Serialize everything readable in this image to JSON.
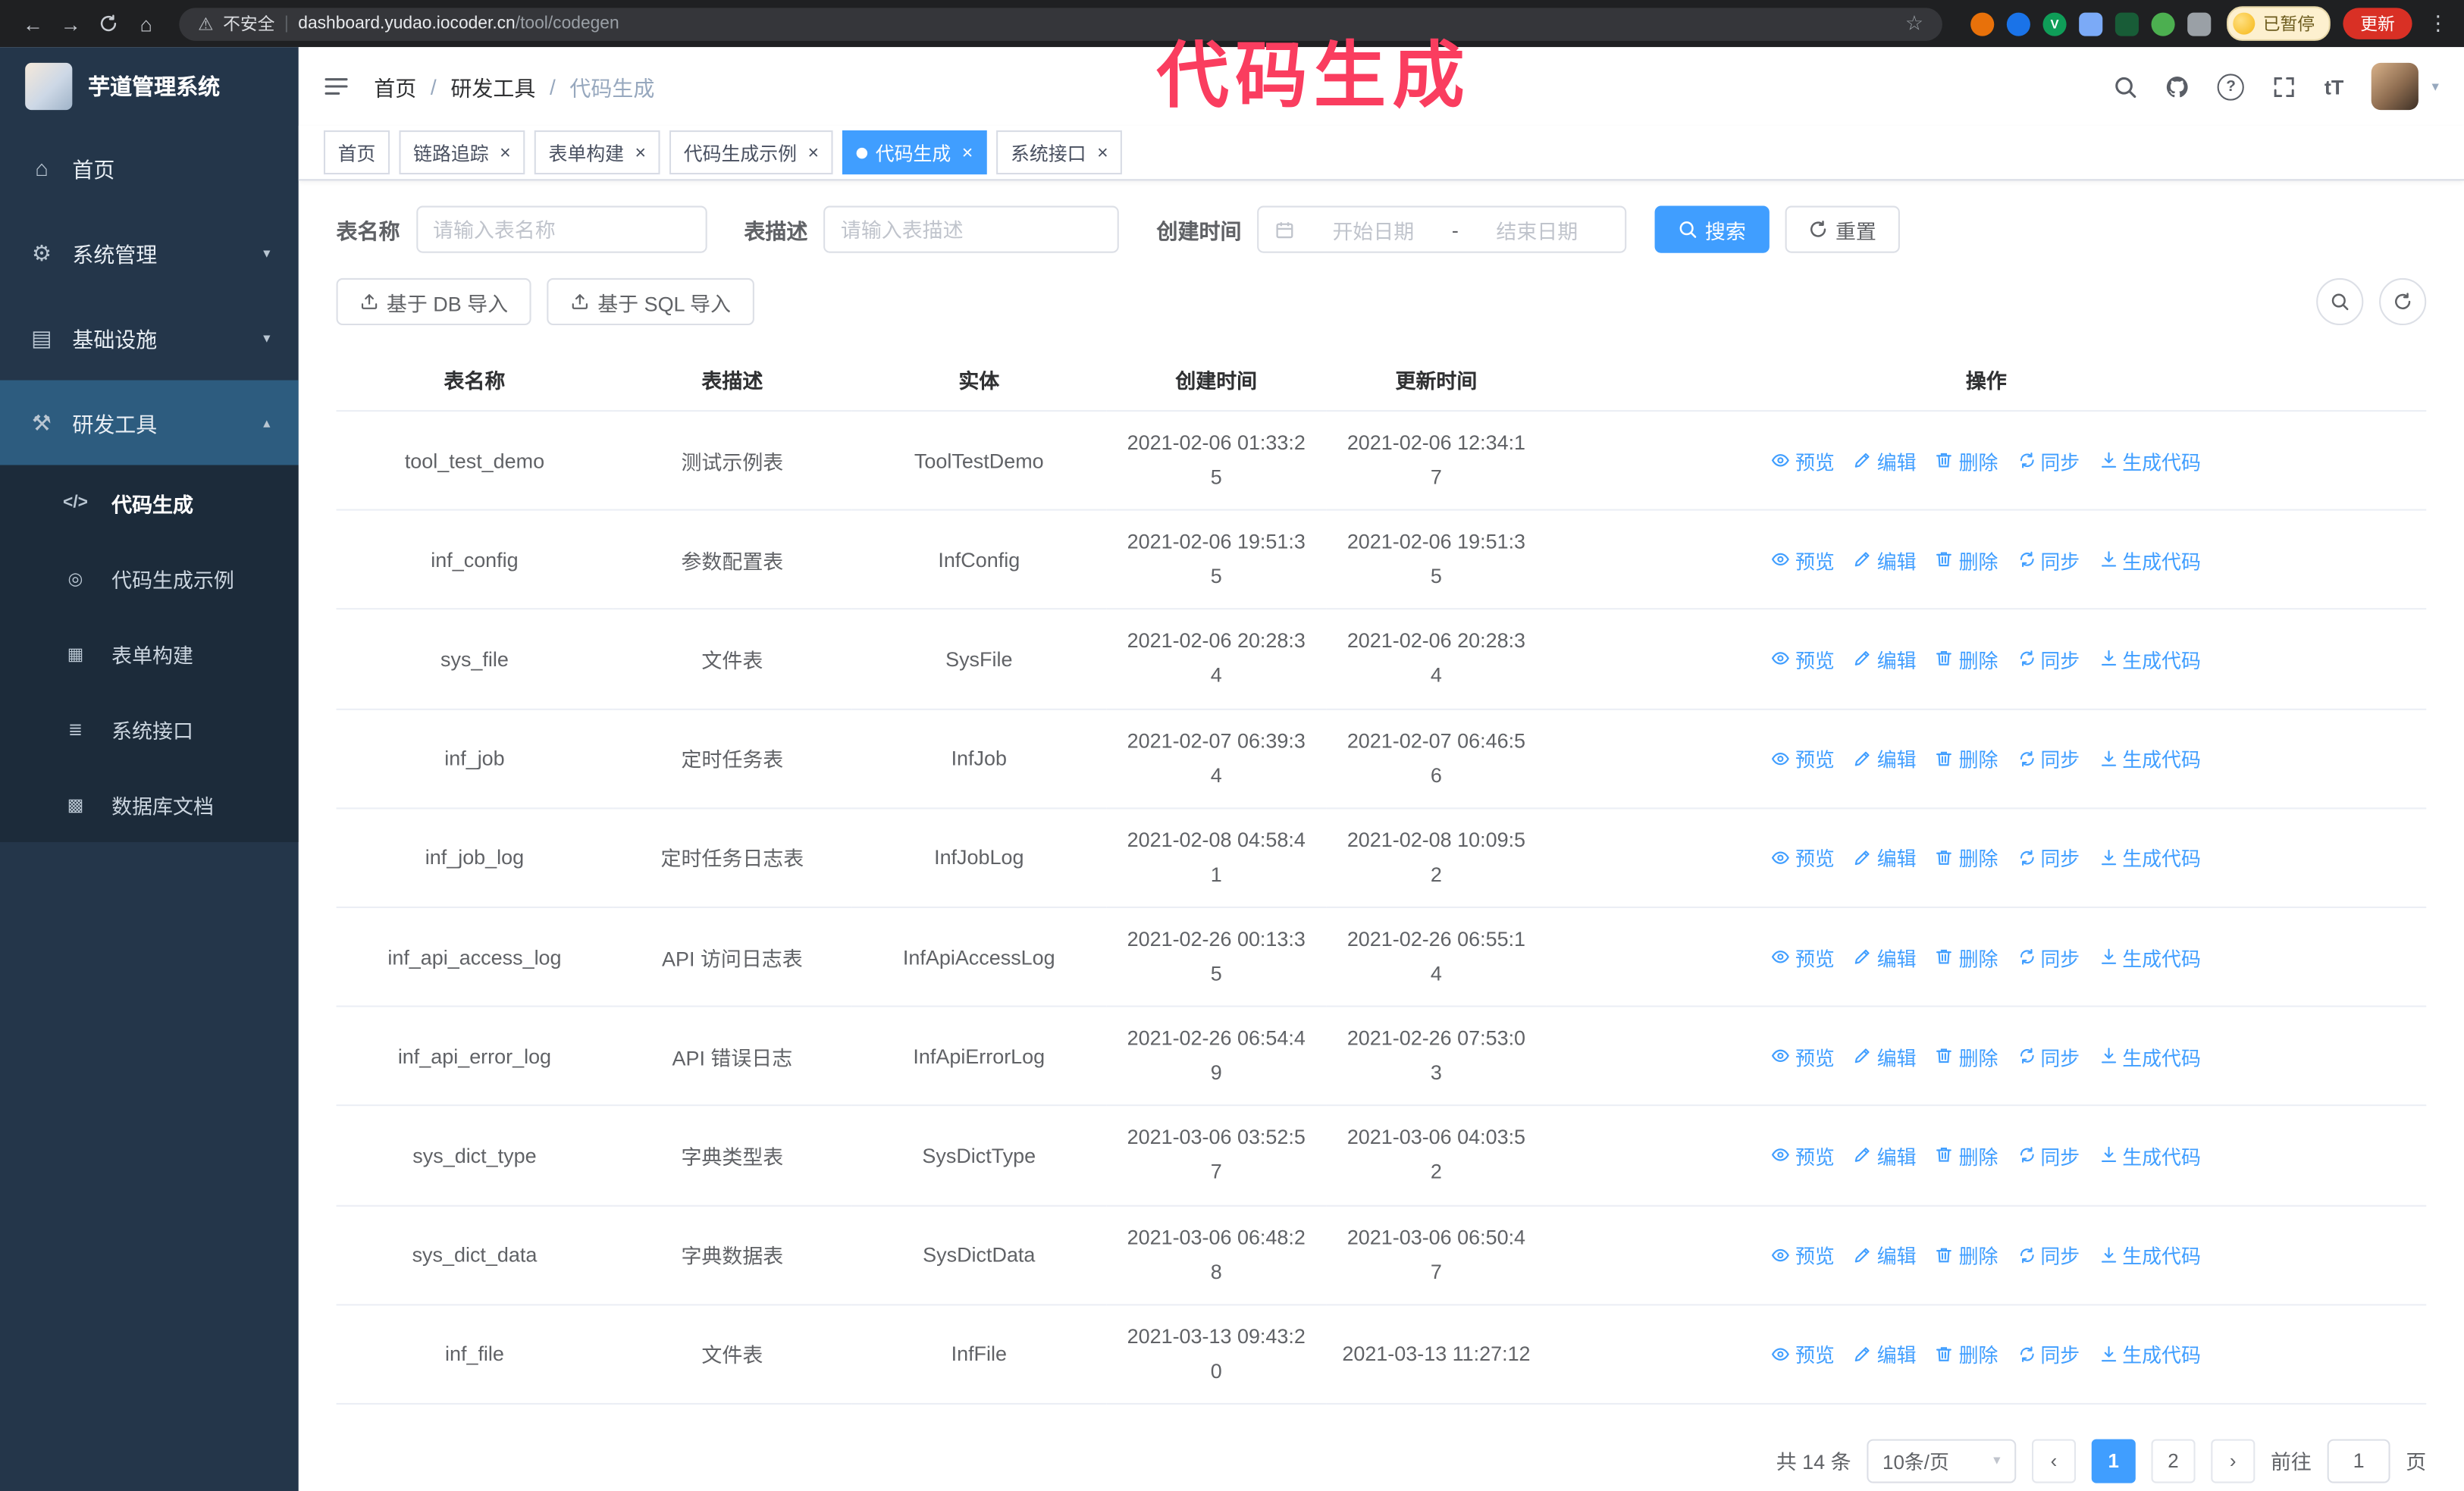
{
  "browser": {
    "security_warning": "不安全",
    "url_host": "dashboard.yudao.iocoder.cn",
    "url_path": "/tool/codegen",
    "paused_badge": "已暂停",
    "update_button": "更新"
  },
  "annotation": {
    "text": "代码生成",
    "color": "#fa3d5f"
  },
  "colors": {
    "accent": "#409eff"
  },
  "sidebar": {
    "logo_title": "芋道管理系统",
    "items": [
      {
        "label": "首页",
        "icon": "home-icon"
      },
      {
        "label": "系统管理",
        "icon": "gear-icon",
        "expandable": true
      },
      {
        "label": "基础设施",
        "icon": "infra-icon",
        "expandable": true
      },
      {
        "label": "研发工具",
        "icon": "tools-icon",
        "expandable": true,
        "expanded": true,
        "children": [
          {
            "label": "代码生成",
            "icon": "code-icon",
            "active": true
          },
          {
            "label": "代码生成示例",
            "icon": "example-icon"
          },
          {
            "label": "表单构建",
            "icon": "form-icon"
          },
          {
            "label": "系统接口",
            "icon": "api-icon"
          },
          {
            "label": "数据库文档",
            "icon": "dbdoc-icon"
          }
        ]
      }
    ]
  },
  "header": {
    "breadcrumb": [
      "首页",
      "研发工具",
      "代码生成"
    ]
  },
  "tabs": [
    {
      "label": "首页",
      "closable": false,
      "active": false
    },
    {
      "label": "链路追踪",
      "closable": true,
      "active": false
    },
    {
      "label": "表单构建",
      "closable": true,
      "active": false
    },
    {
      "label": "代码生成示例",
      "closable": true,
      "active": false
    },
    {
      "label": "代码生成",
      "closable": true,
      "active": true
    },
    {
      "label": "系统接口",
      "closable": true,
      "active": false
    }
  ],
  "filters": {
    "table_name_label": "表名称",
    "table_name_placeholder": "请输入表名称",
    "table_desc_label": "表描述",
    "table_desc_placeholder": "请输入表描述",
    "create_time_label": "创建时间",
    "date_start_placeholder": "开始日期",
    "date_separator": "-",
    "date_end_placeholder": "结束日期",
    "search_button": "搜索",
    "reset_button": "重置"
  },
  "toolbar": {
    "import_db": "基于 DB 导入",
    "import_sql": "基于 SQL 导入"
  },
  "table": {
    "columns": [
      "表名称",
      "表描述",
      "实体",
      "创建时间",
      "更新时间",
      "操作"
    ],
    "actions": [
      "预览",
      "编辑",
      "删除",
      "同步",
      "生成代码"
    ],
    "rows": [
      {
        "name": "tool_test_demo",
        "desc": "测试示例表",
        "entity": "ToolTestDemo",
        "created": "2021-02-06 01:33:25",
        "updated": "2021-02-06 12:34:17"
      },
      {
        "name": "inf_config",
        "desc": "参数配置表",
        "entity": "InfConfig",
        "created": "2021-02-06 19:51:35",
        "updated": "2021-02-06 19:51:35"
      },
      {
        "name": "sys_file",
        "desc": "文件表",
        "entity": "SysFile",
        "created": "2021-02-06 20:28:34",
        "updated": "2021-02-06 20:28:34"
      },
      {
        "name": "inf_job",
        "desc": "定时任务表",
        "entity": "InfJob",
        "created": "2021-02-07 06:39:34",
        "updated": "2021-02-07 06:46:56"
      },
      {
        "name": "inf_job_log",
        "desc": "定时任务日志表",
        "entity": "InfJobLog",
        "created": "2021-02-08 04:58:41",
        "updated": "2021-02-08 10:09:52"
      },
      {
        "name": "inf_api_access_log",
        "desc": "API 访问日志表",
        "entity": "InfApiAccessLog",
        "created": "2021-02-26 00:13:35",
        "updated": "2021-02-26 06:55:14"
      },
      {
        "name": "inf_api_error_log",
        "desc": "API 错误日志",
        "entity": "InfApiErrorLog",
        "created": "2021-02-26 06:54:49",
        "updated": "2021-02-26 07:53:03"
      },
      {
        "name": "sys_dict_type",
        "desc": "字典类型表",
        "entity": "SysDictType",
        "created": "2021-03-06 03:52:57",
        "updated": "2021-03-06 04:03:52"
      },
      {
        "name": "sys_dict_data",
        "desc": "字典数据表",
        "entity": "SysDictData",
        "created": "2021-03-06 06:48:28",
        "updated": "2021-03-06 06:50:47"
      },
      {
        "name": "inf_file",
        "desc": "文件表",
        "entity": "InfFile",
        "created": "2021-03-13 09:43:20",
        "updated": "2021-03-13 11:27:12"
      }
    ]
  },
  "pagination": {
    "total_text": "共 14 条",
    "page_size": "10条/页",
    "pages": [
      "1",
      "2"
    ],
    "active_page": "1",
    "goto_label": "前往",
    "goto_value": "1",
    "goto_suffix": "页"
  }
}
